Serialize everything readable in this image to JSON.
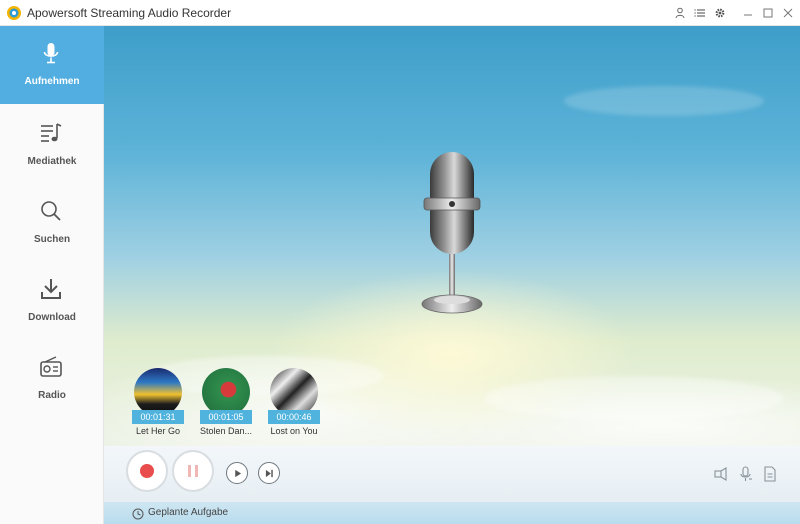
{
  "window": {
    "title": "Apowersoft Streaming Audio Recorder",
    "icons": [
      "user-icon",
      "list-icon",
      "gear-icon",
      "minimize-icon",
      "maximize-icon",
      "close-icon"
    ]
  },
  "sidebar": {
    "items": [
      {
        "label": "Aufnehmen",
        "icon": "microphone-icon",
        "active": true
      },
      {
        "label": "Mediathek",
        "icon": "playlist-icon",
        "active": false
      },
      {
        "label": "Suchen",
        "icon": "search-icon",
        "active": false
      },
      {
        "label": "Download",
        "icon": "download-icon",
        "active": false
      },
      {
        "label": "Radio",
        "icon": "radio-icon",
        "active": false
      }
    ]
  },
  "tracks": [
    {
      "time": "00:01:31",
      "title": "Let Her Go"
    },
    {
      "time": "00:01:05",
      "title": "Stolen Dan..."
    },
    {
      "time": "00:00:46",
      "title": "Lost on You"
    }
  ],
  "controls": {
    "buttons": [
      "record-icon",
      "pause-icon",
      "play-icon",
      "skip-next-icon"
    ],
    "right_icons": [
      "speaker-icon",
      "microphone-settings-icon",
      "file-icon"
    ]
  },
  "status": {
    "scheduled_label": "Geplante Aufgabe"
  },
  "colors": {
    "accent": "#52aee0",
    "record": "#e84c4c",
    "time_tag": "#4fb3dd"
  }
}
